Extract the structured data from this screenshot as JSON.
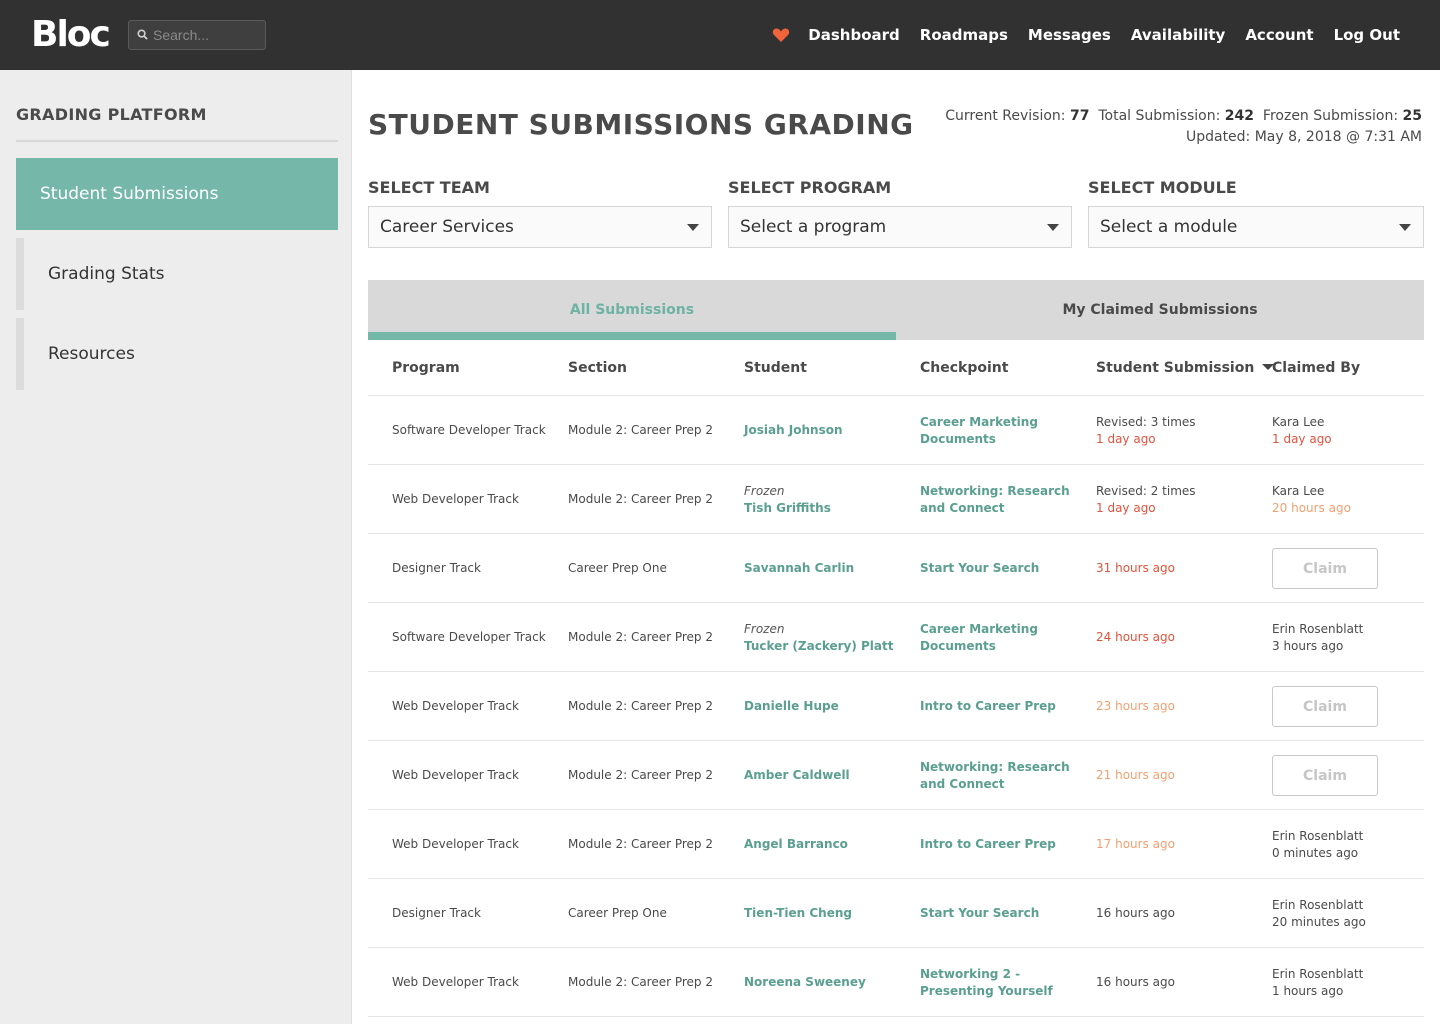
{
  "header": {
    "logo": "Bloc",
    "search_placeholder": "Search...",
    "nav": [
      "Dashboard",
      "Roadmaps",
      "Messages",
      "Availability",
      "Account",
      "Log Out"
    ],
    "accent_color": "#f0643c"
  },
  "sidebar": {
    "title": "GRADING PLATFORM",
    "items": [
      {
        "label": "Student Submissions",
        "active": true
      },
      {
        "label": "Grading Stats",
        "active": false
      },
      {
        "label": "Resources",
        "active": false
      }
    ],
    "active_color": "#75b8aa"
  },
  "main": {
    "title": "STUDENT SUBMISSIONS GRADING",
    "stats": {
      "revision_label": "Current Revision:",
      "revision_value": "77",
      "total_label": "Total Submission:",
      "total_value": "242",
      "frozen_label": "Frozen Submission:",
      "frozen_value": "25",
      "updated": "Updated: May 8, 2018 @ 7:31 AM"
    },
    "filters": {
      "team": {
        "label": "SELECT TEAM",
        "value": "Career Services"
      },
      "program": {
        "label": "SELECT PROGRAM",
        "value": "Select a program"
      },
      "module": {
        "label": "SELECT MODULE",
        "value": "Select a module"
      }
    },
    "tabs": [
      {
        "label": "All Submissions",
        "active": true
      },
      {
        "label": "My Claimed Submissions",
        "active": false
      }
    ],
    "columns": [
      "Program",
      "Section",
      "Student",
      "Checkpoint",
      "Student Submission",
      "Claimed By"
    ],
    "claim_label": "Claim",
    "rows": [
      {
        "program": "Software Developer Track",
        "section": "Module 2: Career Prep 2",
        "frozen": "",
        "student": "Josiah Johnson",
        "checkpoint": "Career Marketing Documents",
        "sub_note": "Revised: 3 times",
        "sub_time": "1 day ago",
        "sub_color": "red",
        "claimer": "Kara Lee",
        "claim_time": "1 day ago",
        "claim_color": "red"
      },
      {
        "program": "Web Developer Track",
        "section": "Module 2: Career Prep 2",
        "frozen": "Frozen",
        "student": "Tish Griffiths",
        "checkpoint": "Networking: Research and Connect",
        "sub_note": "Revised: 2 times",
        "sub_time": "1 day ago",
        "sub_color": "red",
        "claimer": "Kara Lee",
        "claim_time": "20 hours ago",
        "claim_color": "orange"
      },
      {
        "program": "Designer Track",
        "section": "Career Prep One",
        "frozen": "",
        "student": "Savannah Carlin",
        "checkpoint": "Start Your Search",
        "sub_note": "",
        "sub_time": "31 hours ago",
        "sub_color": "red",
        "claimer": "",
        "claim_time": "",
        "claim_color": ""
      },
      {
        "program": "Software Developer Track",
        "section": "Module 2: Career Prep 2",
        "frozen": "Frozen",
        "student": "Tucker (Zackery) Platt",
        "checkpoint": "Career Marketing Documents",
        "sub_note": "",
        "sub_time": "24 hours ago",
        "sub_color": "red",
        "claimer": "Erin Rosenblatt",
        "claim_time": "3 hours ago",
        "claim_color": "plain"
      },
      {
        "program": "Web Developer Track",
        "section": "Module 2: Career Prep 2",
        "frozen": "",
        "student": "Danielle Hupe",
        "checkpoint": "Intro to Career Prep",
        "sub_note": "",
        "sub_time": "23 hours ago",
        "sub_color": "orange",
        "claimer": "",
        "claim_time": "",
        "claim_color": ""
      },
      {
        "program": "Web Developer Track",
        "section": "Module 2: Career Prep 2",
        "frozen": "",
        "student": "Amber Caldwell",
        "checkpoint": "Networking: Research and Connect",
        "sub_note": "",
        "sub_time": "21 hours ago",
        "sub_color": "orange",
        "claimer": "",
        "claim_time": "",
        "claim_color": ""
      },
      {
        "program": "Web Developer Track",
        "section": "Module 2: Career Prep 2",
        "frozen": "",
        "student": "Angel Barranco",
        "checkpoint": "Intro to Career Prep",
        "sub_note": "",
        "sub_time": "17 hours ago",
        "sub_color": "orange",
        "claimer": "Erin Rosenblatt",
        "claim_time": "0 minutes ago",
        "claim_color": "plain"
      },
      {
        "program": "Designer Track",
        "section": "Career Prep One",
        "frozen": "",
        "student": "Tien-Tien Cheng",
        "checkpoint": "Start Your Search",
        "sub_note": "",
        "sub_time": "16 hours ago",
        "sub_color": "plain",
        "claimer": "Erin Rosenblatt",
        "claim_time": "20 minutes ago",
        "claim_color": "plain"
      },
      {
        "program": "Web Developer Track",
        "section": "Module 2: Career Prep 2",
        "frozen": "",
        "student": "Noreena Sweeney",
        "checkpoint": "Networking 2 - Presenting Yourself",
        "sub_note": "",
        "sub_time": "16 hours ago",
        "sub_color": "plain",
        "claimer": "Erin Rosenblatt",
        "claim_time": "1 hours ago",
        "claim_color": "plain"
      }
    ]
  }
}
